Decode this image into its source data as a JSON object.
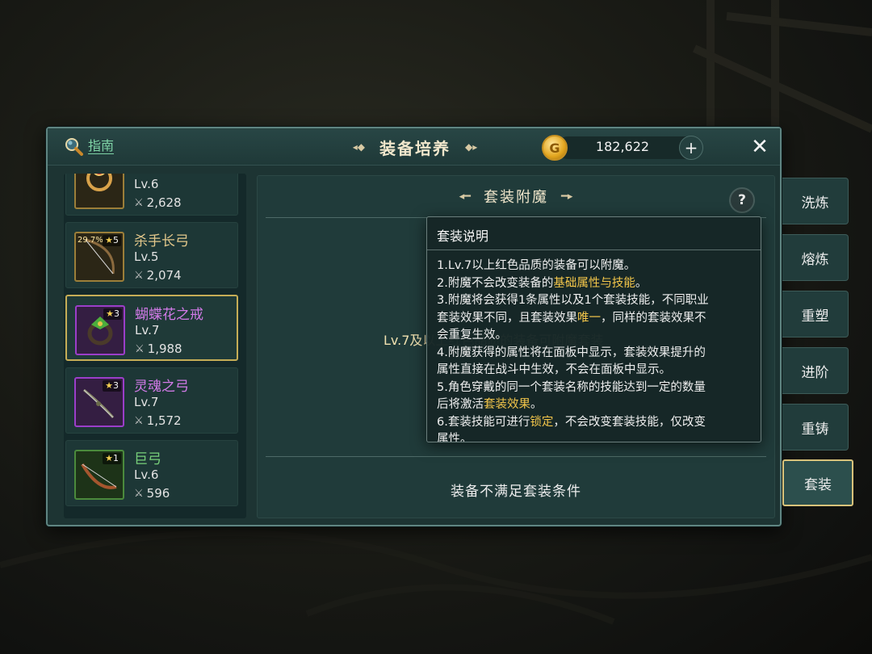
{
  "header": {
    "guide_label": "指南",
    "title": "装备培养",
    "title_ornament_left": "⊸",
    "title_ornament_right": "⊸",
    "currency_symbol": "G",
    "currency_amount": "182,622",
    "plus_label": "+",
    "close_label": "✕"
  },
  "equipment_list": [
    {
      "name": "",
      "level": "Lv.6",
      "power": "2,628",
      "quality": "gold",
      "stars": "",
      "percent": "",
      "icon": "ruby-ring-icon"
    },
    {
      "name": "杀手长弓",
      "level": "Lv.5",
      "power": "2,074",
      "quality": "gold",
      "stars": "5",
      "percent": "29.7%",
      "icon": "longbow-icon",
      "name_color": "#e2c78b"
    },
    {
      "name": "蝴蝶花之戒",
      "level": "Lv.7",
      "power": "1,988",
      "quality": "purple",
      "stars": "3",
      "percent": "",
      "icon": "leaf-ring-icon",
      "name_color": "#d27ae8",
      "selected": true
    },
    {
      "name": "灵魂之弓",
      "level": "Lv.7",
      "power": "1,572",
      "quality": "purple",
      "stars": "3",
      "percent": "",
      "icon": "soul-bow-icon",
      "name_color": "#d27ae8"
    },
    {
      "name": "巨弓",
      "level": "Lv.6",
      "power": "596",
      "quality": "green",
      "stars": "1",
      "percent": "",
      "icon": "great-bow-icon",
      "name_color": "#78d07a"
    }
  ],
  "content": {
    "section_title": "套装附魔",
    "help_label": "?",
    "requirement_text": "Lv.7及以上红色品质的装备可附魔套装",
    "status_text": "装备不满足套装条件"
  },
  "tooltip": {
    "title": "套装说明",
    "lines": [
      [
        {
          "t": "1.Lv.7以上红色品质的装备可以附魔。"
        }
      ],
      [
        {
          "t": "2.附魔不会改变装备的"
        },
        {
          "t": "基础属性与技能",
          "hl": true
        },
        {
          "t": "。"
        }
      ],
      [
        {
          "t": "3.附魔将会获得1条属性以及1个套装技能，不同职业"
        }
      ],
      [
        {
          "t": "套装效果不同，且套装效果"
        },
        {
          "t": "唯一",
          "hl": true
        },
        {
          "t": "，同样的套装效果不"
        }
      ],
      [
        {
          "t": "会重复生效。"
        }
      ],
      [
        {
          "t": "4.附魔获得的属性将在面板中显示，套装效果提升的"
        }
      ],
      [
        {
          "t": "属性直接在战斗中生效，不会在面板中显示。"
        }
      ],
      [
        {
          "t": "5.角色穿戴的同一个套装名称的技能达到一定的数量"
        }
      ],
      [
        {
          "t": "后将激活"
        },
        {
          "t": "套装效果",
          "hl": true
        },
        {
          "t": "。"
        }
      ],
      [
        {
          "t": "6.套装技能可进行"
        },
        {
          "t": "锁定",
          "hl": true
        },
        {
          "t": "，不会改变套装技能，仅改变"
        }
      ],
      [
        {
          "t": "属性。"
        }
      ]
    ]
  },
  "side_tabs": [
    {
      "label": "洗炼",
      "active": false
    },
    {
      "label": "熔炼",
      "active": false
    },
    {
      "label": "重塑",
      "active": false
    },
    {
      "label": "进阶",
      "active": false
    },
    {
      "label": "重铸",
      "active": false
    },
    {
      "label": "套装",
      "active": true
    }
  ],
  "colors": {
    "accent_gold": "#f3c64a",
    "panel_teal": "#1d3433",
    "purple_quality": "#9b3ec9",
    "green_quality": "#4b8a3c",
    "gold_quality": "#9b7e39"
  }
}
